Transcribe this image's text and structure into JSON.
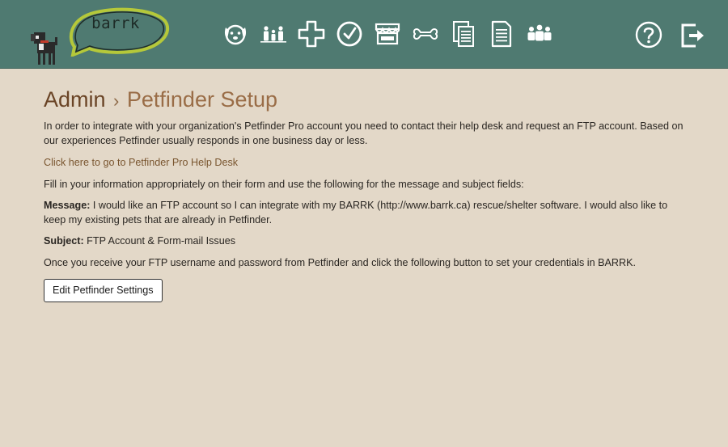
{
  "app": {
    "logo_text": "barrk"
  },
  "nav": {
    "items": [
      {
        "icon": "dog-face-icon"
      },
      {
        "icon": "family-icon"
      },
      {
        "icon": "medical-cross-icon"
      },
      {
        "icon": "clock-check-icon"
      },
      {
        "icon": "store-icon"
      },
      {
        "icon": "bone-icon"
      },
      {
        "icon": "documents-icon"
      },
      {
        "icon": "document-icon"
      },
      {
        "icon": "people-icon"
      }
    ],
    "right": [
      {
        "icon": "help-icon"
      },
      {
        "icon": "logout-icon"
      }
    ]
  },
  "breadcrumb": {
    "root": "Admin",
    "separator": "›",
    "leaf": "Petfinder Setup"
  },
  "content": {
    "intro": "In order to integrate with your organization's Petfinder Pro account you need to contact their help desk and request an FTP account. Based on our experiences Petfinder usually responds in one business day or less.",
    "help_link": "Click here to go to Petfinder Pro Help Desk",
    "instructions": "Fill in your information appropriately on their form and use the following for the message and subject fields:",
    "message_label": "Message:",
    "message_text": " I would like an FTP account so I can integrate with my BARRK (http://www.barrk.ca) rescue/shelter software. I would also like to keep my existing pets that are already in Petfinder.",
    "subject_label": "Subject:",
    "subject_text": " FTP Account & Form-mail Issues",
    "followup": "Once you receive your FTP username and password from Petfinder and click the following button to set your credentials in BARRK.",
    "edit_button": "Edit Petfinder Settings"
  },
  "colors": {
    "header_bg": "#4f7a71",
    "page_bg": "#e3d8c8",
    "title_brown": "#9a6d47",
    "link_brown": "#7a5630"
  }
}
